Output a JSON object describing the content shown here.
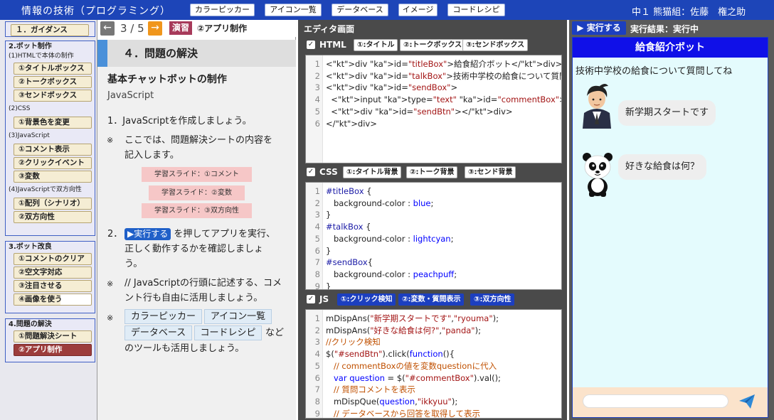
{
  "header": {
    "title": "情報の技術（プログラミング）",
    "tools": [
      "カラーピッカー",
      "アイコン一覧",
      "データベース",
      "イメージ",
      "コードレシピ"
    ],
    "user": "中１ 熊猫組：佐藤　権之助"
  },
  "sidebar": {
    "guidance": "１．ガイダンス",
    "bot_make": {
      "title": "2.ボット制作",
      "html_sub": "(1)HTMLで本体の制作",
      "html_items": [
        "①タイトルボックス",
        "②トークボックス",
        "③センドボックス"
      ],
      "css_sub": "(2)CSS",
      "css_items": [
        "①背景色を変更"
      ],
      "js_sub": "(3)JavaScript",
      "js_items": [
        "①コメント表示",
        "②クリックイベント",
        "③変数"
      ],
      "dual_sub": "(4)JavaScriptで双方向性",
      "dual_items": [
        "①配列（シナリオ）",
        "②双方向性"
      ]
    },
    "bot_improve": {
      "title": "3.ボット改良",
      "items": [
        "①コメントのクリア",
        "②空文字対応",
        "③注目させる",
        "④画像を使う"
      ],
      "last_item_progress": 0.6
    },
    "solve": {
      "title": "4.問題の解決",
      "items": [
        "①問題解決シート",
        "②アプリ制作"
      ]
    }
  },
  "lesson": {
    "prev_arrow": "←",
    "page": "3 / 5",
    "next_arrow": "→",
    "tag": "演習",
    "heading": "②アプリ制作",
    "section_title": "４．問題の解決",
    "subtitle": "基本チャットボットの制作",
    "subtitle2": "JavaScript",
    "step1": "1．JavaScriptを作成しましょう。",
    "note_mark": "※",
    "note1_line1": "ここでは、問題解決シートの内容を",
    "note1_line2": "記入します。",
    "slides": [
      "学習スライド：①コメント",
      "学習スライド：②変数",
      "学習スライド：③双方向性"
    ],
    "step2_num": "2．",
    "step2_btn": "▶実行する",
    "step2_line1": "を押してアプリを実行、",
    "step2_line2": "正しく動作するかを確認しましょ",
    "step2_line3": "う。",
    "note2_line1": "// JavaScriptの行頭に記述する、コメ",
    "note2_line2": "ント行も自由に活用しましょう。",
    "tools": [
      "カラーピッカー",
      "アイコン一覧",
      "データベース",
      "コードレシピ"
    ],
    "tools_suffix": "など",
    "tools_line2": "のツールも活用しましょう。"
  },
  "editor": {
    "title": "エディタ画面",
    "check_glyph": "✓",
    "html": {
      "label": "HTML",
      "snippets": [
        "①:タイトル",
        "②:トークボックス",
        "③:センドボックス"
      ],
      "lines": [
        [
          "<div id=\"titleBox\">給食紹介ボット</div>"
        ],
        [
          "<div id=\"talkBox\">技術中学校の給食について質問してね</div>"
        ],
        [
          "<div id=\"sendBox\">"
        ],
        [
          "  <input type=\"text\" id=\"commentBox\">"
        ],
        [
          "  <div id=\"sendBtn\"></div>"
        ],
        [
          "</div>"
        ]
      ]
    },
    "css": {
      "label": "CSS",
      "snippets": [
        "①:タイトル背景",
        "②:トーク背景",
        "③:センド背景"
      ],
      "lines": [
        "#titleBox {",
        "   background-color : blue;",
        "}",
        "#talkBox {",
        "   background-color : lightcyan;",
        "}",
        "#sendBox{",
        "   background-color : peachpuff;",
        "}"
      ]
    },
    "js": {
      "label": "JS",
      "snippets": [
        "①:クリック検知",
        "②:変数・質問表示",
        "③:双方向性"
      ],
      "lines": [
        "mDispAns(\"新学期スタートです\",\"ryouma\");",
        "mDispAns(\"好きな給食は何?\",\"panda\");",
        "//クリック検知",
        "$(\"#sendBtn\").click(function(){",
        "   // commentBoxの値を変数questionに代入",
        "   var question = $(\"#commentBox\").val();",
        "   // 質問コメントを表示",
        "   mDispQue(question,\"ikkyuu\");",
        "   // データベースから回答を取得して表示"
      ]
    }
  },
  "result": {
    "run_button": "▶ 実行する",
    "label": "実行結果：実行中",
    "bot_title": "給食紹介ボット",
    "talk_text": "技術中学校の給食について質問してね",
    "messages": [
      {
        "text": "新学期スタートです",
        "avatar": "ryouma-avatar"
      },
      {
        "text": "好きな給食は何？",
        "avatar": "panda-avatar"
      }
    ],
    "comment_value": ""
  }
}
